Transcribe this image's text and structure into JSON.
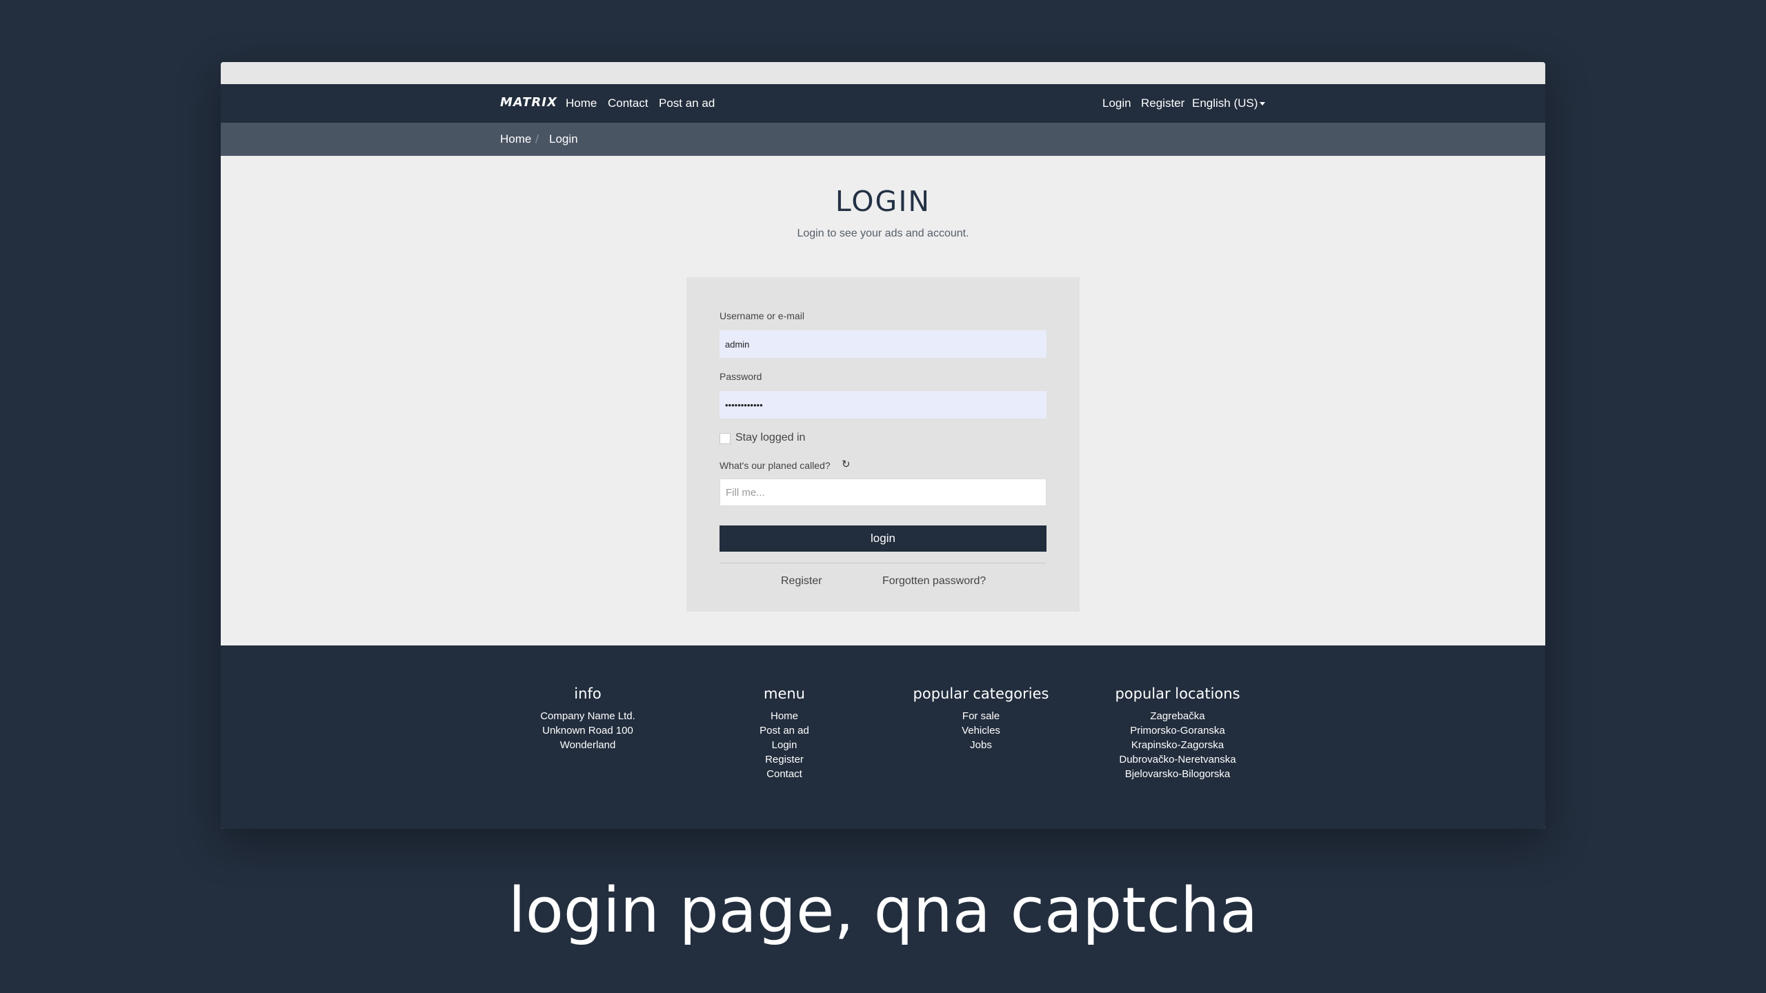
{
  "nav": {
    "brand": "MATRIX",
    "links": [
      "Home",
      "Contact",
      "Post an ad"
    ],
    "right_links": [
      "Login",
      "Register"
    ],
    "language": "English (US)"
  },
  "breadcrumb": [
    "Home",
    "Login"
  ],
  "page": {
    "title": "LOGIN",
    "subtitle": "Login to see your ads and account."
  },
  "form": {
    "username_label": "Username or e-mail",
    "username_value": "admin",
    "password_label": "Password",
    "password_value": "••••••••••••",
    "stay_logged_in": "Stay logged in",
    "stay_logged_in_checked": false,
    "question_label": "What's our planed called?",
    "answer_placeholder": "Fill me...",
    "submit_label": "login",
    "register_link": "Register",
    "forgot_link": "Forgotten password?"
  },
  "footer": {
    "info": {
      "heading": "info",
      "items": [
        "Company Name Ltd.",
        "Unknown Road 100",
        "Wonderland"
      ]
    },
    "menu": {
      "heading": "menu",
      "items": [
        "Home",
        "Post an ad",
        "Login",
        "Register",
        "Contact"
      ]
    },
    "categories": {
      "heading": "popular categories",
      "items": [
        "For sale",
        "Vehicles",
        "Jobs"
      ]
    },
    "locations": {
      "heading": "popular locations",
      "items": [
        "Zagrebačka",
        "Primorsko-Goranska",
        "Krapinsko-Zagorska",
        "Dubrovačko-Neretvanska",
        "Bjelovarsko-Bilogorska"
      ]
    }
  },
  "caption": "login page, qna captcha",
  "colors": {
    "background": "#232e3e",
    "navbar": "#222d3d",
    "breadcrumb_bar": "#4a5564",
    "content": "#eeeeee",
    "card": "#e2e2e2",
    "button": "#222d3d",
    "autofill_input": "#e8ecfb"
  },
  "icons": {
    "refresh": "refresh-icon",
    "dropdown": "caret-down-icon"
  }
}
